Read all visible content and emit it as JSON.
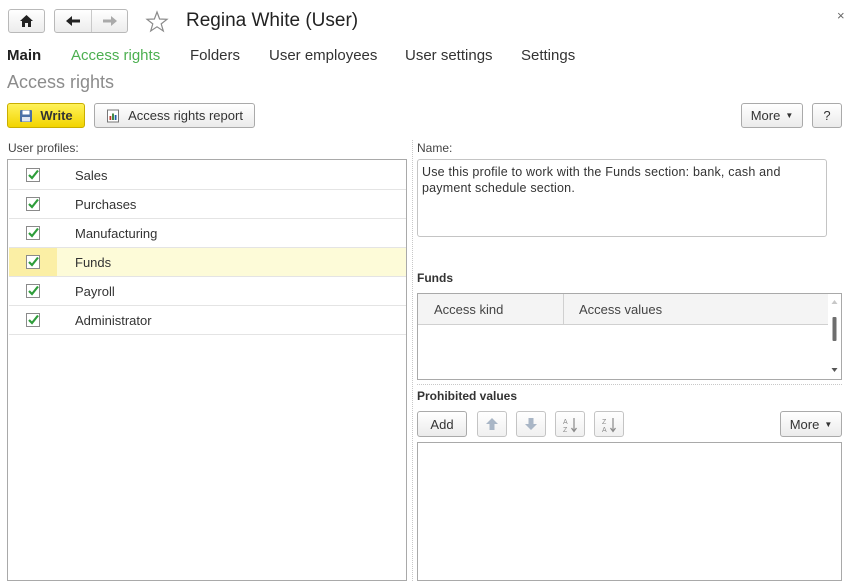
{
  "window": {
    "title": "Regina White (User)",
    "close_glyph": "×"
  },
  "nav": {
    "home_icon": "home-icon",
    "back_icon": "arrow-left-icon",
    "forward_icon": "arrow-right-icon",
    "favorite_icon": "star-icon"
  },
  "tabs": [
    {
      "label": "Main"
    },
    {
      "label": "Access rights"
    },
    {
      "label": "Folders"
    },
    {
      "label": "User employees"
    },
    {
      "label": "User settings"
    },
    {
      "label": "Settings"
    }
  ],
  "page": {
    "section_title": "Access rights"
  },
  "toolbar": {
    "write_label": "Write",
    "report_label": "Access rights report",
    "more_label": "More",
    "help_label": "?"
  },
  "profiles": {
    "label": "User profiles:",
    "items": [
      {
        "label": "Sales",
        "checked": true
      },
      {
        "label": "Purchases",
        "checked": true
      },
      {
        "label": "Manufacturing",
        "checked": true
      },
      {
        "label": "Funds",
        "checked": true,
        "selected": true
      },
      {
        "label": "Payroll",
        "checked": true
      },
      {
        "label": "Administrator",
        "checked": true
      }
    ]
  },
  "details": {
    "name_label": "Name:",
    "name_value": "Use this profile to work with the Funds section: bank, cash and payment schedule  section.",
    "group_title": "Funds",
    "columns": [
      "Access kind",
      "Access values"
    ]
  },
  "prohibited": {
    "title": "Prohibited values",
    "add_label": "Add",
    "more_label": "More"
  },
  "colors": {
    "accent_tab": "#4caf50",
    "write_button": "#f2d400",
    "selected_row": "#fdfbd8",
    "checkmark": "#2e9d3a"
  }
}
